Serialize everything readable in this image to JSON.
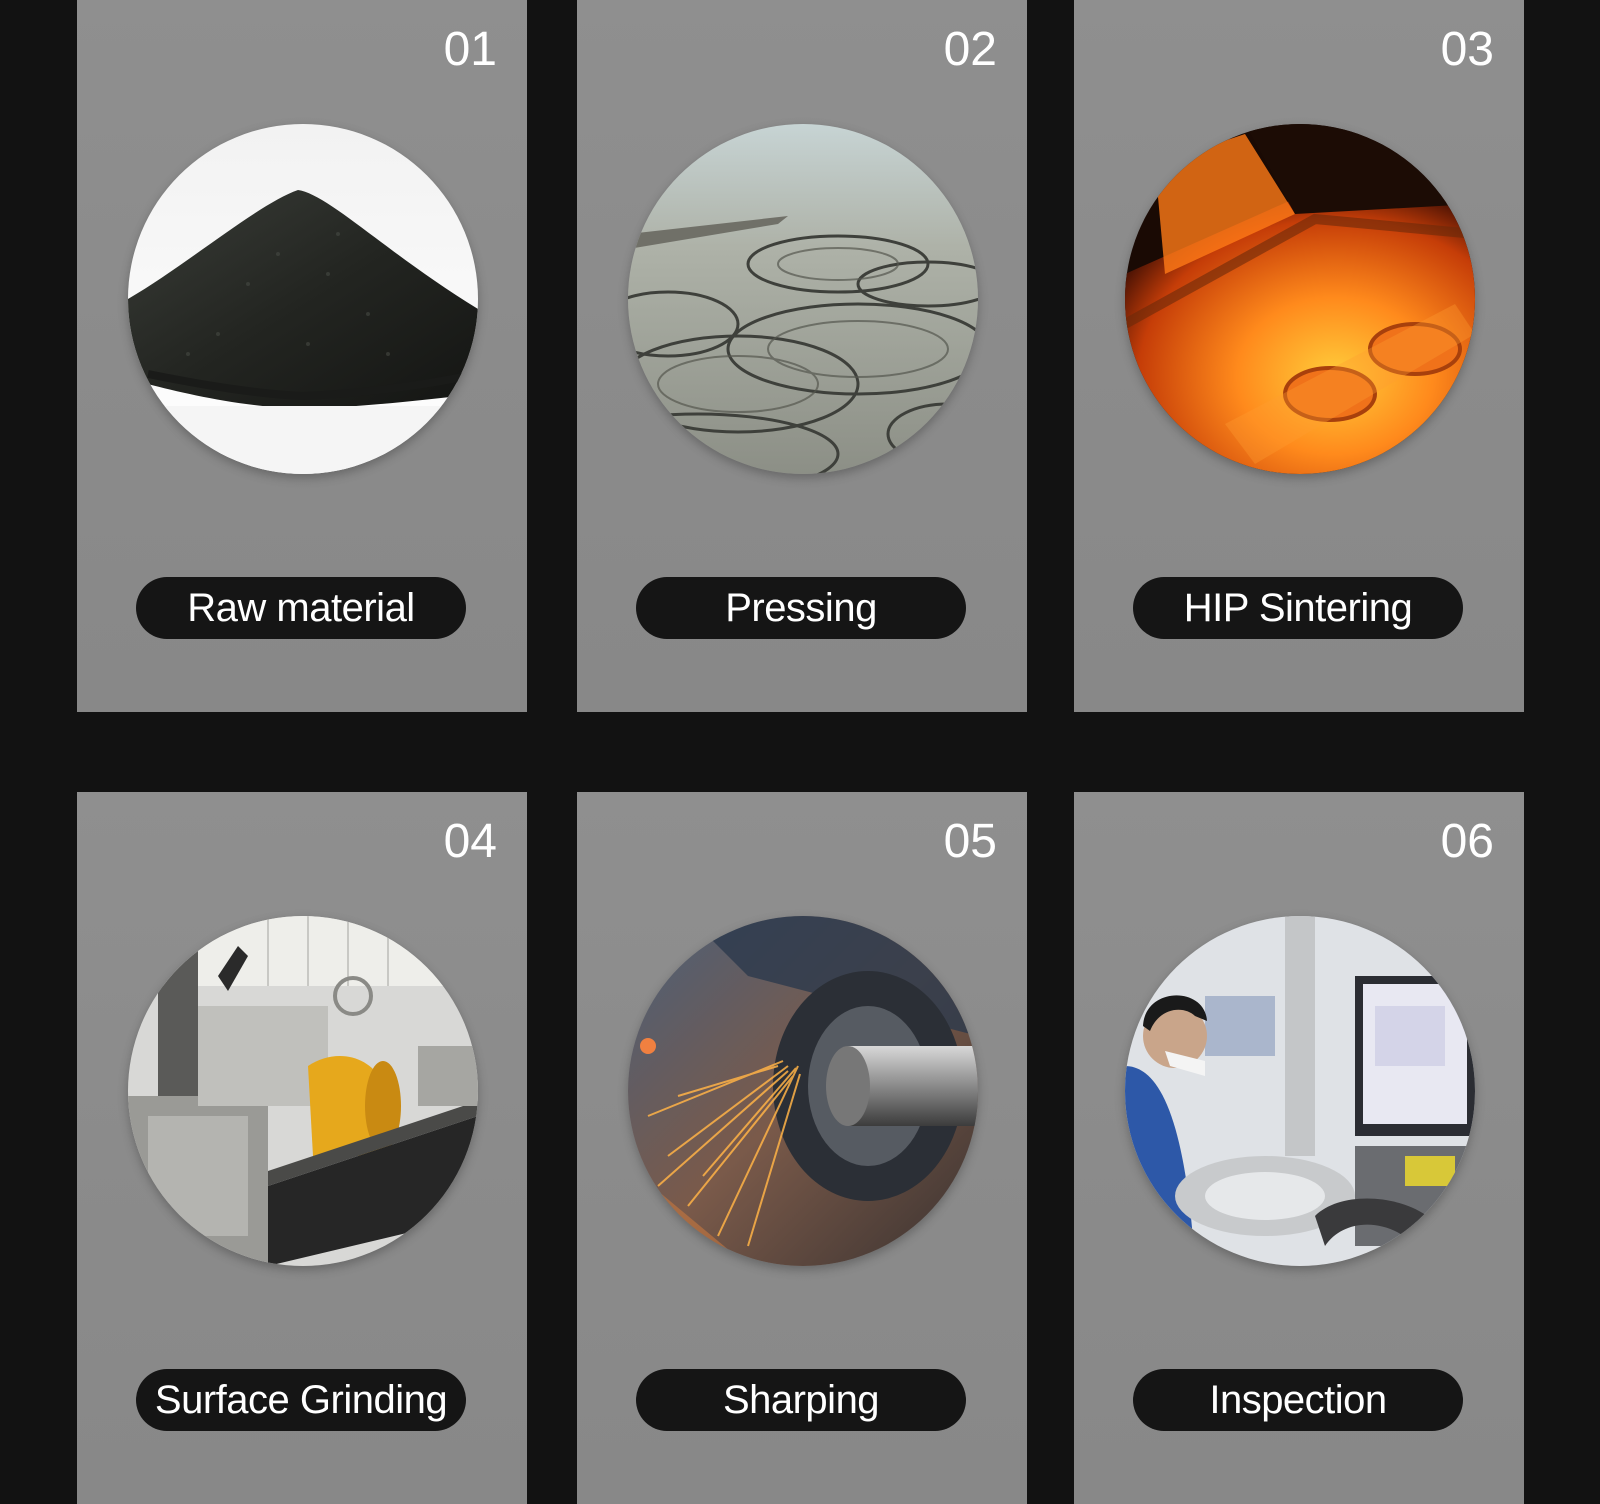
{
  "steps": [
    {
      "number": "01",
      "label": "Raw material",
      "image": "black-powder-pile"
    },
    {
      "number": "02",
      "label": "Pressing",
      "image": "pressed-circular-blanks"
    },
    {
      "number": "03",
      "label": "HIP Sintering",
      "image": "glowing-sintering-furnace"
    },
    {
      "number": "04",
      "label": "Surface Grinding",
      "image": "grinding-machine-workshop"
    },
    {
      "number": "05",
      "label": "Sharping",
      "image": "grinding-wheel-sparks"
    },
    {
      "number": "06",
      "label": "Inspection",
      "image": "worker-inspection-station"
    }
  ],
  "colors": {
    "background": "#121212",
    "card": "#8b8b8b",
    "pill": "#151515",
    "text": "#ffffff"
  }
}
